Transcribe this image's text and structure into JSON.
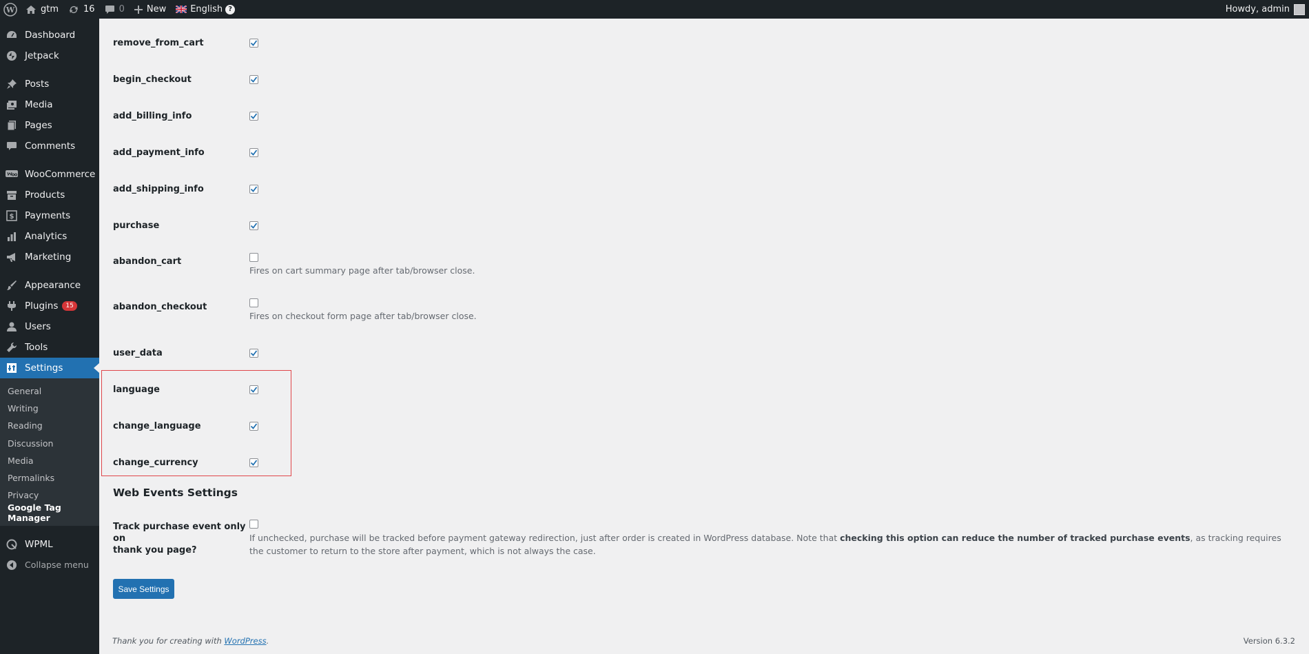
{
  "adminbar": {
    "site_name": "gtm",
    "updates_count": "16",
    "comments_count": "0",
    "new_label": "New",
    "language_label": "English",
    "help_glyph": "?",
    "greeting": "Howdy, admin"
  },
  "sidebar": {
    "items": [
      {
        "label": "Dashboard",
        "icon": "dashboard-icon"
      },
      {
        "label": "Jetpack",
        "icon": "jetpack-icon"
      },
      {
        "label": "Posts",
        "icon": "pin-icon"
      },
      {
        "label": "Media",
        "icon": "media-icon"
      },
      {
        "label": "Pages",
        "icon": "pages-icon"
      },
      {
        "label": "Comments",
        "icon": "comment-icon"
      },
      {
        "label": "WooCommerce",
        "icon": "woo-icon"
      },
      {
        "label": "Products",
        "icon": "archive-icon"
      },
      {
        "label": "Payments",
        "icon": "dollar-icon"
      },
      {
        "label": "Analytics",
        "icon": "bar-chart-icon"
      },
      {
        "label": "Marketing",
        "icon": "megaphone-icon"
      },
      {
        "label": "Appearance",
        "icon": "paintbrush-icon"
      },
      {
        "label": "Plugins",
        "icon": "plug-icon",
        "badge": "15"
      },
      {
        "label": "Users",
        "icon": "user-icon"
      },
      {
        "label": "Tools",
        "icon": "wrench-icon"
      },
      {
        "label": "Settings",
        "icon": "settings-icon"
      }
    ],
    "submenu": [
      "General",
      "Writing",
      "Reading",
      "Discussion",
      "Media",
      "Permalinks",
      "Privacy",
      "Google Tag Manager"
    ],
    "wpml_label": "WPML",
    "collapse_label": "Collapse menu"
  },
  "events": [
    {
      "name": "remove_from_cart",
      "checked": true
    },
    {
      "name": "begin_checkout",
      "checked": true
    },
    {
      "name": "add_billing_info",
      "checked": true
    },
    {
      "name": "add_payment_info",
      "checked": true
    },
    {
      "name": "add_shipping_info",
      "checked": true
    },
    {
      "name": "purchase",
      "checked": true
    },
    {
      "name": "abandon_cart",
      "checked": false,
      "description": "Fires on cart summary page after tab/browser close."
    },
    {
      "name": "abandon_checkout",
      "checked": false,
      "description": "Fires on checkout form page after tab/browser close."
    },
    {
      "name": "user_data",
      "checked": true
    },
    {
      "name": "language",
      "checked": true
    },
    {
      "name": "change_language",
      "checked": true
    },
    {
      "name": "change_currency",
      "checked": true
    }
  ],
  "web_events": {
    "title": "Web Events Settings",
    "track_label_line1": "Track purchase event only on",
    "track_label_line2": "thank you page?",
    "track_checked": false,
    "desc_part1": "If unchecked, purchase will be tracked before payment gateway redirection, just after order is created in WordPress database. Note that ",
    "desc_bold": "checking this option can reduce the number of tracked purchase events",
    "desc_part2": ", as tracking requires the customer to return to the store after payment, which is not always the case."
  },
  "save_button": "Save Settings",
  "footer": {
    "thanks_prefix": "Thank you for creating with ",
    "wordpress_link": "WordPress",
    "thanks_suffix": ".",
    "version": "Version 6.3.2"
  },
  "colors": {
    "adminbar_bg": "#1d2327",
    "accent": "#2271b1",
    "badge": "#d63638",
    "highlight_border": "#e0464a"
  }
}
